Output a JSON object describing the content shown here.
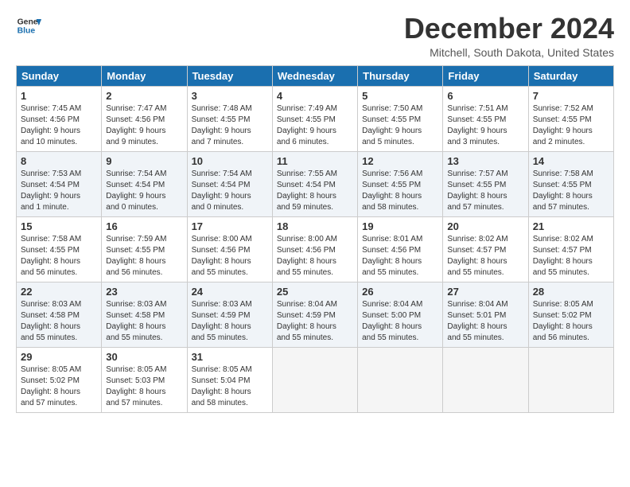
{
  "logo": {
    "line1": "General",
    "line2": "Blue"
  },
  "title": "December 2024",
  "location": "Mitchell, South Dakota, United States",
  "days_header": [
    "Sunday",
    "Monday",
    "Tuesday",
    "Wednesday",
    "Thursday",
    "Friday",
    "Saturday"
  ],
  "weeks": [
    [
      {
        "day": "1",
        "info": "Sunrise: 7:45 AM\nSunset: 4:56 PM\nDaylight: 9 hours\nand 10 minutes."
      },
      {
        "day": "2",
        "info": "Sunrise: 7:47 AM\nSunset: 4:56 PM\nDaylight: 9 hours\nand 9 minutes."
      },
      {
        "day": "3",
        "info": "Sunrise: 7:48 AM\nSunset: 4:55 PM\nDaylight: 9 hours\nand 7 minutes."
      },
      {
        "day": "4",
        "info": "Sunrise: 7:49 AM\nSunset: 4:55 PM\nDaylight: 9 hours\nand 6 minutes."
      },
      {
        "day": "5",
        "info": "Sunrise: 7:50 AM\nSunset: 4:55 PM\nDaylight: 9 hours\nand 5 minutes."
      },
      {
        "day": "6",
        "info": "Sunrise: 7:51 AM\nSunset: 4:55 PM\nDaylight: 9 hours\nand 3 minutes."
      },
      {
        "day": "7",
        "info": "Sunrise: 7:52 AM\nSunset: 4:55 PM\nDaylight: 9 hours\nand 2 minutes."
      }
    ],
    [
      {
        "day": "8",
        "info": "Sunrise: 7:53 AM\nSunset: 4:54 PM\nDaylight: 9 hours\nand 1 minute."
      },
      {
        "day": "9",
        "info": "Sunrise: 7:54 AM\nSunset: 4:54 PM\nDaylight: 9 hours\nand 0 minutes."
      },
      {
        "day": "10",
        "info": "Sunrise: 7:54 AM\nSunset: 4:54 PM\nDaylight: 9 hours\nand 0 minutes."
      },
      {
        "day": "11",
        "info": "Sunrise: 7:55 AM\nSunset: 4:54 PM\nDaylight: 8 hours\nand 59 minutes."
      },
      {
        "day": "12",
        "info": "Sunrise: 7:56 AM\nSunset: 4:55 PM\nDaylight: 8 hours\nand 58 minutes."
      },
      {
        "day": "13",
        "info": "Sunrise: 7:57 AM\nSunset: 4:55 PM\nDaylight: 8 hours\nand 57 minutes."
      },
      {
        "day": "14",
        "info": "Sunrise: 7:58 AM\nSunset: 4:55 PM\nDaylight: 8 hours\nand 57 minutes."
      }
    ],
    [
      {
        "day": "15",
        "info": "Sunrise: 7:58 AM\nSunset: 4:55 PM\nDaylight: 8 hours\nand 56 minutes."
      },
      {
        "day": "16",
        "info": "Sunrise: 7:59 AM\nSunset: 4:55 PM\nDaylight: 8 hours\nand 56 minutes."
      },
      {
        "day": "17",
        "info": "Sunrise: 8:00 AM\nSunset: 4:56 PM\nDaylight: 8 hours\nand 55 minutes."
      },
      {
        "day": "18",
        "info": "Sunrise: 8:00 AM\nSunset: 4:56 PM\nDaylight: 8 hours\nand 55 minutes."
      },
      {
        "day": "19",
        "info": "Sunrise: 8:01 AM\nSunset: 4:56 PM\nDaylight: 8 hours\nand 55 minutes."
      },
      {
        "day": "20",
        "info": "Sunrise: 8:02 AM\nSunset: 4:57 PM\nDaylight: 8 hours\nand 55 minutes."
      },
      {
        "day": "21",
        "info": "Sunrise: 8:02 AM\nSunset: 4:57 PM\nDaylight: 8 hours\nand 55 minutes."
      }
    ],
    [
      {
        "day": "22",
        "info": "Sunrise: 8:03 AM\nSunset: 4:58 PM\nDaylight: 8 hours\nand 55 minutes."
      },
      {
        "day": "23",
        "info": "Sunrise: 8:03 AM\nSunset: 4:58 PM\nDaylight: 8 hours\nand 55 minutes."
      },
      {
        "day": "24",
        "info": "Sunrise: 8:03 AM\nSunset: 4:59 PM\nDaylight: 8 hours\nand 55 minutes."
      },
      {
        "day": "25",
        "info": "Sunrise: 8:04 AM\nSunset: 4:59 PM\nDaylight: 8 hours\nand 55 minutes."
      },
      {
        "day": "26",
        "info": "Sunrise: 8:04 AM\nSunset: 5:00 PM\nDaylight: 8 hours\nand 55 minutes."
      },
      {
        "day": "27",
        "info": "Sunrise: 8:04 AM\nSunset: 5:01 PM\nDaylight: 8 hours\nand 55 minutes."
      },
      {
        "day": "28",
        "info": "Sunrise: 8:05 AM\nSunset: 5:02 PM\nDaylight: 8 hours\nand 56 minutes."
      }
    ],
    [
      {
        "day": "29",
        "info": "Sunrise: 8:05 AM\nSunset: 5:02 PM\nDaylight: 8 hours\nand 57 minutes."
      },
      {
        "day": "30",
        "info": "Sunrise: 8:05 AM\nSunset: 5:03 PM\nDaylight: 8 hours\nand 57 minutes."
      },
      {
        "day": "31",
        "info": "Sunrise: 8:05 AM\nSunset: 5:04 PM\nDaylight: 8 hours\nand 58 minutes."
      },
      {
        "day": "",
        "info": ""
      },
      {
        "day": "",
        "info": ""
      },
      {
        "day": "",
        "info": ""
      },
      {
        "day": "",
        "info": ""
      }
    ]
  ]
}
